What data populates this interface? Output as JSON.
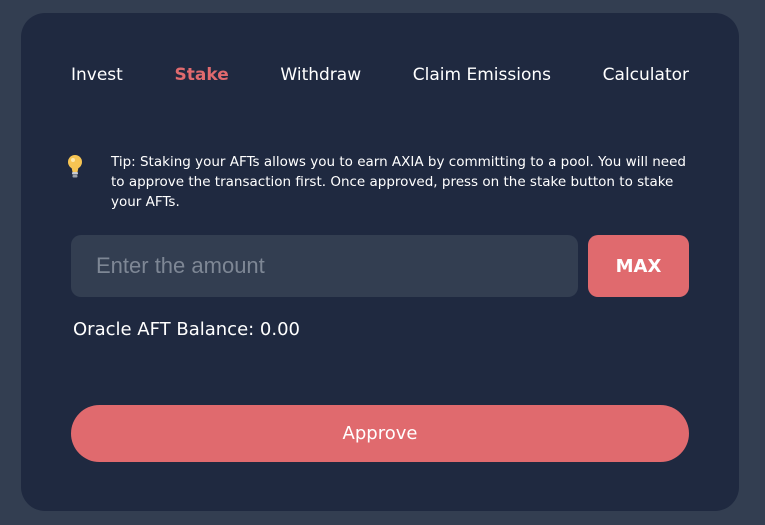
{
  "tabs": [
    {
      "label": "Invest",
      "active": false
    },
    {
      "label": "Stake",
      "active": true
    },
    {
      "label": "Withdraw",
      "active": false
    },
    {
      "label": "Claim Emissions",
      "active": false
    },
    {
      "label": "Calculator",
      "active": false
    }
  ],
  "tip": {
    "icon": "lightbulb-icon",
    "text": "Tip: Staking your AFTs allows you to earn AXIA by committing to a pool. You will need to approve the transaction first. Once approved, press on the stake button to stake your AFTs."
  },
  "amount": {
    "placeholder": "Enter the amount",
    "value": ""
  },
  "max_label": "MAX",
  "balance_text": "Oracle AFT Balance: 0.00",
  "approve_label": "Approve",
  "colors": {
    "page_bg": "#333e51",
    "card_bg": "#1f2940",
    "accent": "#e06a6e",
    "input_bg": "#333e51",
    "text": "#ffffff",
    "bulb": "#f6c453"
  }
}
